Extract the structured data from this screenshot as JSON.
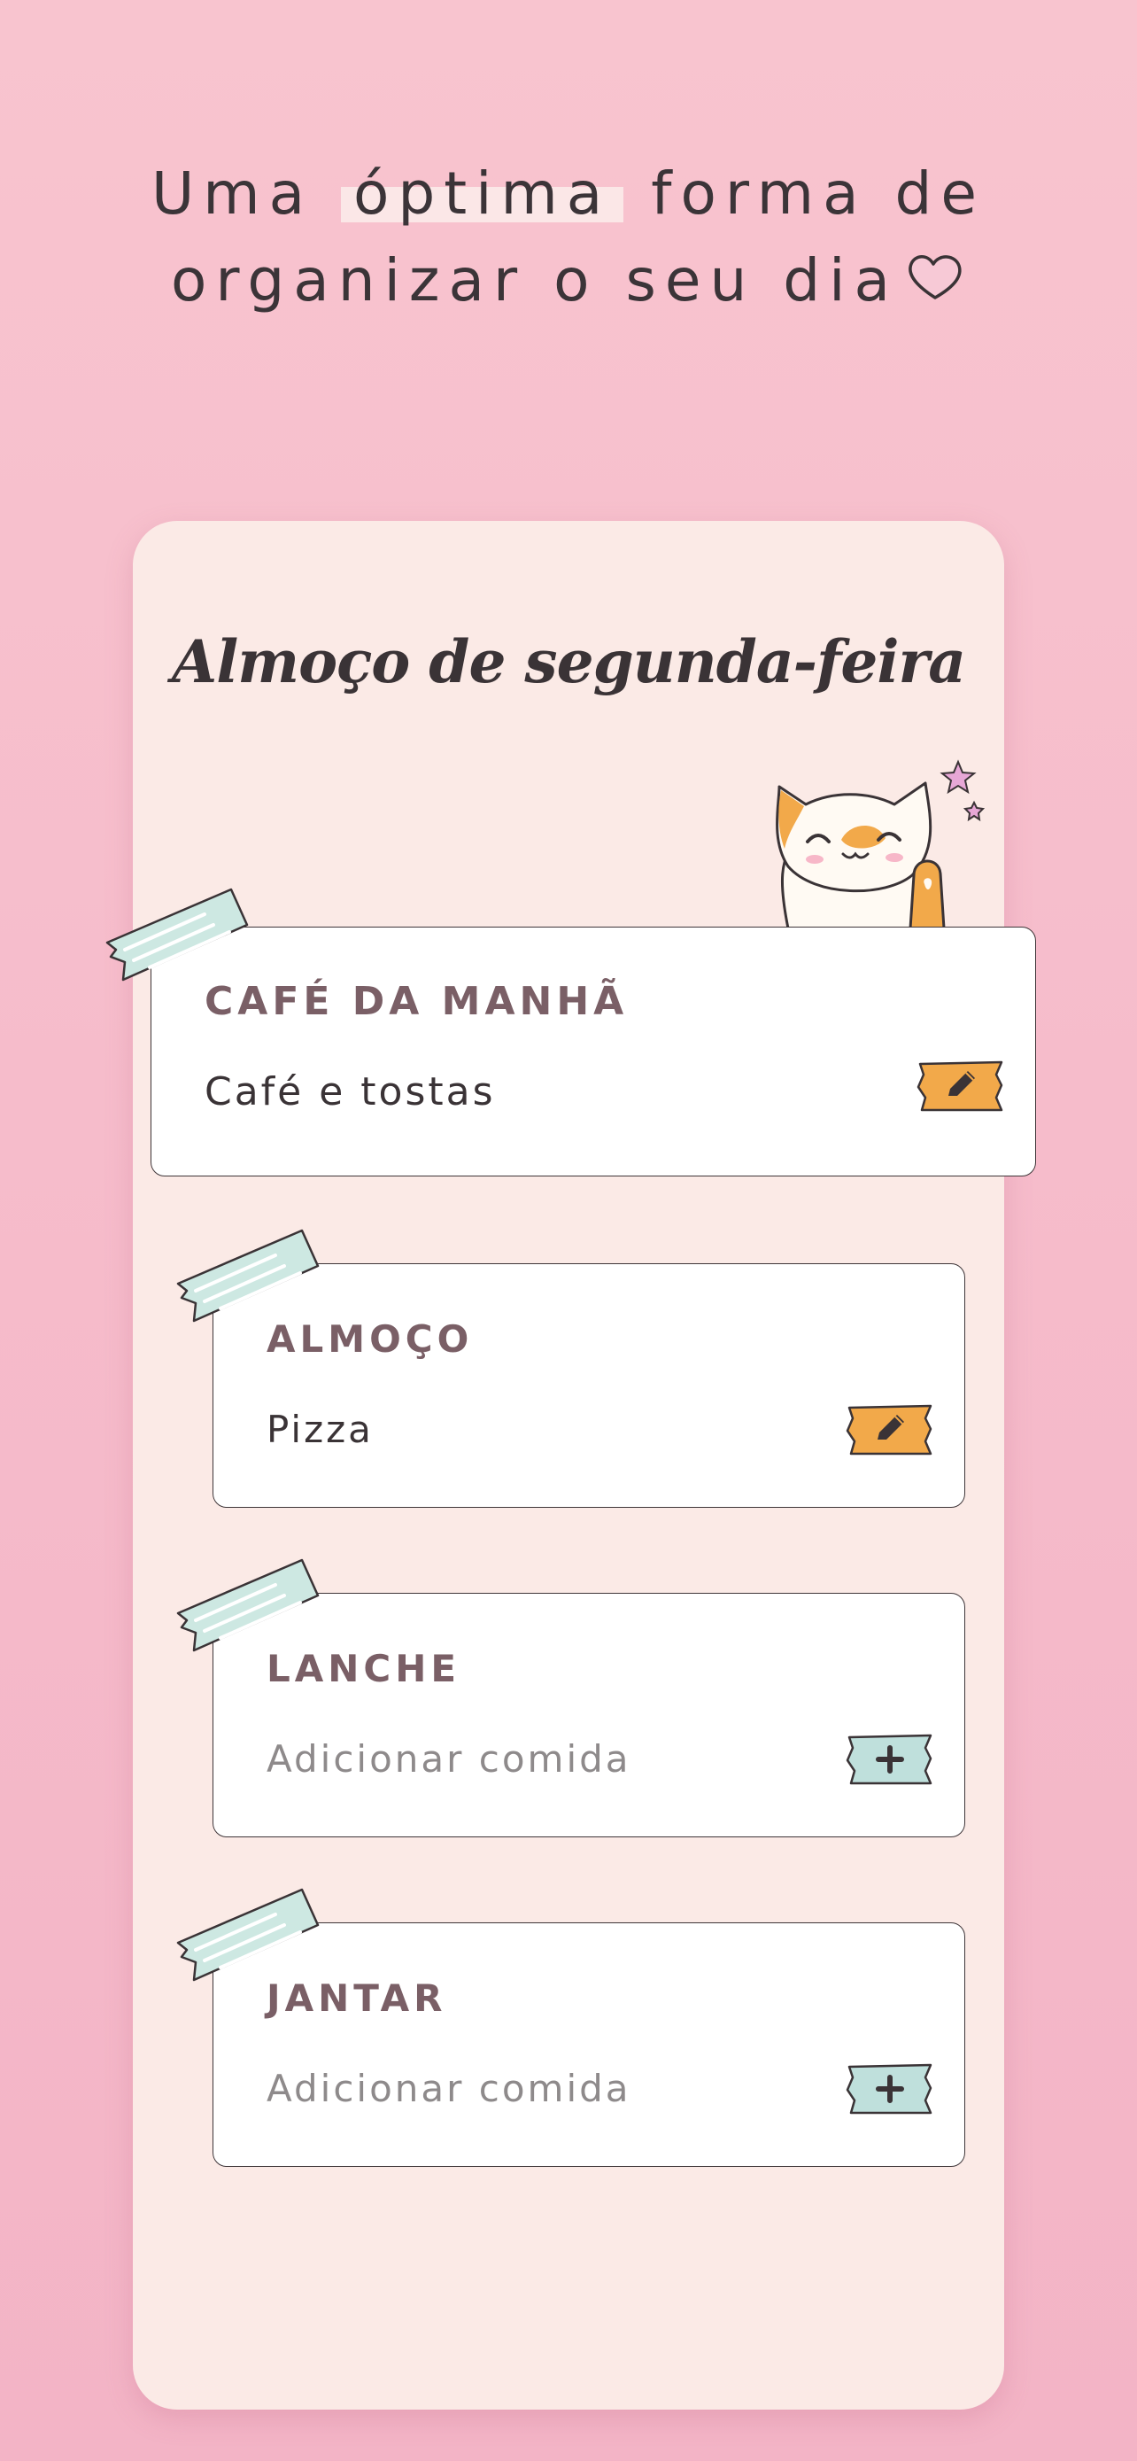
{
  "headline": {
    "line1_before": "Uma ",
    "line1_highlight": "óptima",
    "line1_after": " forma de",
    "line2": "organizar o seu dia"
  },
  "card": {
    "title": "Almoço de segunda-feira"
  },
  "meals": [
    {
      "label": "CAFÉ DA MANHÃ",
      "value": "Café e tostas",
      "action": "edit",
      "placeholder": false
    },
    {
      "label": "ALMOÇO",
      "value": "Pizza",
      "action": "edit",
      "placeholder": false
    },
    {
      "label": "LANCHE",
      "value": "Adicionar comida",
      "action": "add",
      "placeholder": true
    },
    {
      "label": "JANTAR",
      "value": "Adicionar comida",
      "action": "add",
      "placeholder": true
    }
  ],
  "icons": {
    "edit": "pencil-icon",
    "add": "plus-icon",
    "decor": [
      "heart-icon",
      "cat-illustration",
      "star-icon",
      "washi-tape"
    ]
  },
  "colors": {
    "background": "#f6bccb",
    "card": "#fbeae6",
    "edit_tag": "#f2a94a",
    "add_tag": "#bfe0dc",
    "tape": "#cde8e2",
    "label": "#7a5f66",
    "text": "#3a3336",
    "placeholder": "#8e8a8b"
  }
}
